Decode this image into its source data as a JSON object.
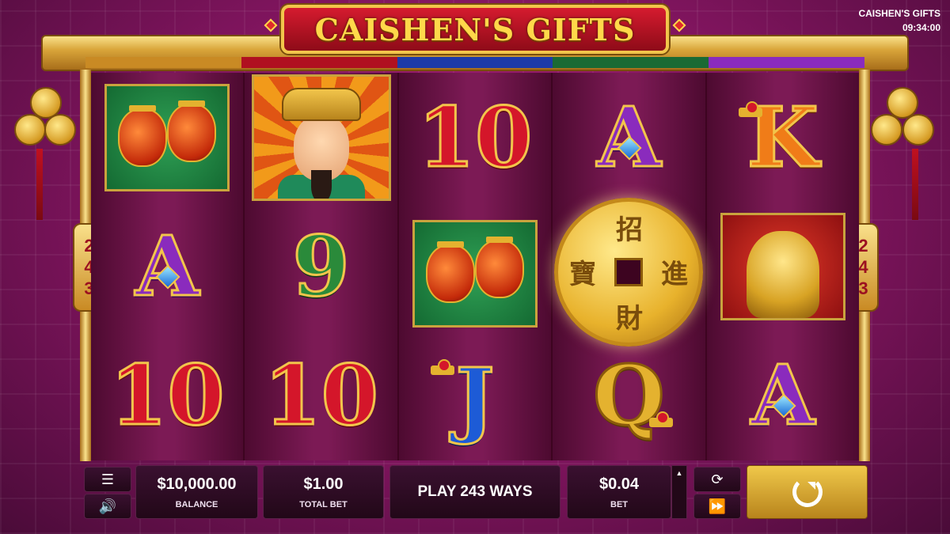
{
  "game": {
    "title": "CAISHEN'S GIFTS",
    "corner_title": "CAISHEN'S GIFTS",
    "clock": "09:34:00",
    "ways_badge": "243"
  },
  "reels": [
    [
      "lanterns-green-tile",
      "A",
      "10"
    ],
    [
      "caishen-god-tile",
      "9",
      "10"
    ],
    [
      "10",
      "lanterns-green-tile",
      "J"
    ],
    [
      "A",
      "gold-coin-symbol",
      "Q"
    ],
    [
      "K",
      "golden-lion-red-tile",
      "A"
    ]
  ],
  "coin_characters": [
    "招",
    "寶",
    "進",
    "財"
  ],
  "controls": {
    "menu_icon": "menu-icon",
    "sound_icon": "speaker-icon",
    "balance_value": "$10,000.00",
    "balance_label": "BALANCE",
    "total_bet_value": "$1.00",
    "total_bet_label": "TOTAL BET",
    "play_ways": "PLAY 243 WAYS",
    "bet_value": "$0.04",
    "bet_label": "BET",
    "autoplay_icon": "autoplay-icon",
    "turbo_icon": "fast-forward-icon",
    "spin_icon": "spin-icon"
  },
  "colors": {
    "accent_gold": "#f2c54b",
    "title_red": "#d51b2f",
    "background_magenta": "#7d145c"
  }
}
